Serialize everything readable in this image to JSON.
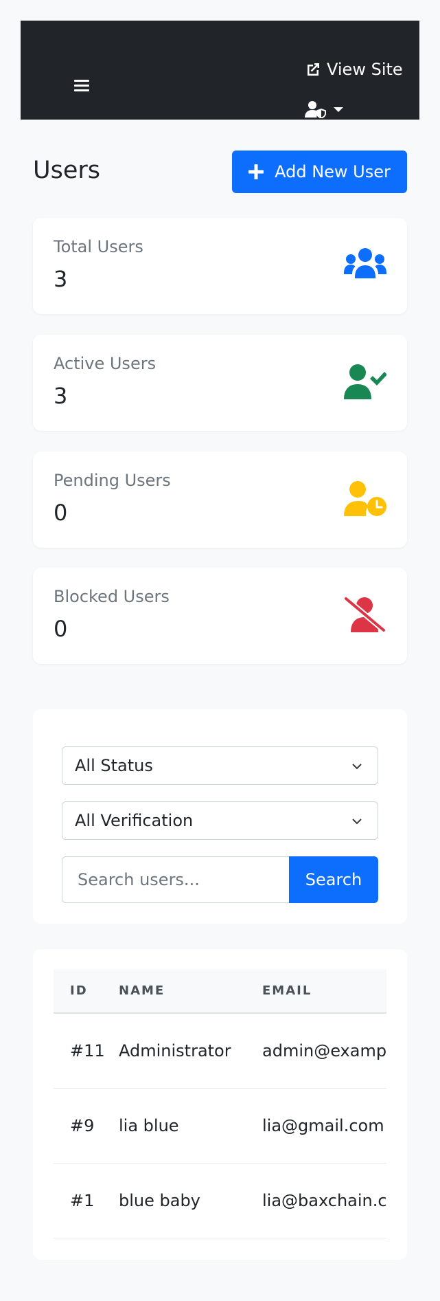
{
  "topbar": {
    "view_site_label": "View Site"
  },
  "page": {
    "title": "Users",
    "add_button_label": "Add New User"
  },
  "stats": [
    {
      "label": "Total Users",
      "value": "3",
      "color": "#0d6efd",
      "icon": "users-icon"
    },
    {
      "label": "Active Users",
      "value": "3",
      "color": "#198754",
      "icon": "user-check-icon"
    },
    {
      "label": "Pending Users",
      "value": "0",
      "color": "#ffc107",
      "icon": "user-clock-icon"
    },
    {
      "label": "Blocked Users",
      "value": "0",
      "color": "#dc3545",
      "icon": "user-slash-icon"
    }
  ],
  "filters": {
    "status_selected": "All Status",
    "verification_selected": "All Verification",
    "search_placeholder": "Search users...",
    "search_button_label": "Search"
  },
  "table": {
    "headers": [
      "ID",
      "NAME",
      "EMAIL"
    ],
    "rows": [
      {
        "id": "#11",
        "name": "Administrator",
        "email": "admin@example.com"
      },
      {
        "id": "#9",
        "name": "lia blue",
        "email": "lia@gmail.com"
      },
      {
        "id": "#1",
        "name": "blue baby",
        "email": "lia@baxchain.com"
      }
    ]
  },
  "colors": {
    "primary": "#0d6efd",
    "topbar": "#212529",
    "background": "#f8f9fa"
  }
}
